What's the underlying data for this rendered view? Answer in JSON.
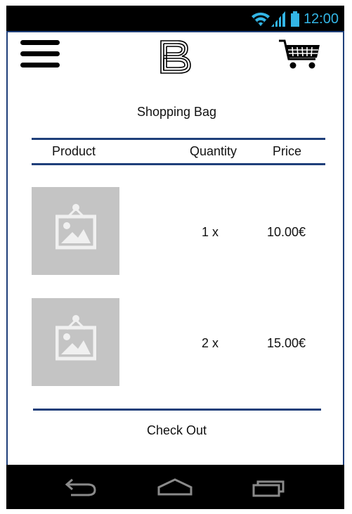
{
  "status_bar": {
    "time": "12:00",
    "icons": [
      "wifi-icon",
      "signal-icon",
      "battery-icon"
    ]
  },
  "header": {
    "menu_icon": "hamburger-menu-icon",
    "logo_icon": "brand-logo-b",
    "cart_icon": "shopping-cart-icon"
  },
  "page": {
    "title": "Shopping Bag"
  },
  "table": {
    "headers": [
      "Product",
      "Quantity",
      "Price"
    ],
    "rows": [
      {
        "image": "image-placeholder-icon",
        "quantity": "1 x",
        "price": "10.00€"
      },
      {
        "image": "image-placeholder-icon",
        "quantity": "2 x",
        "price": "15.00€"
      }
    ]
  },
  "checkout": {
    "label": "Check Out"
  },
  "nav_bar": {
    "buttons": [
      "back-icon",
      "home-icon",
      "recent-apps-icon"
    ]
  },
  "colors": {
    "accent": "#1f3f7a",
    "status_clock": "#33b5e5",
    "placeholder": "#c4c4c4",
    "bars": "#000000"
  }
}
